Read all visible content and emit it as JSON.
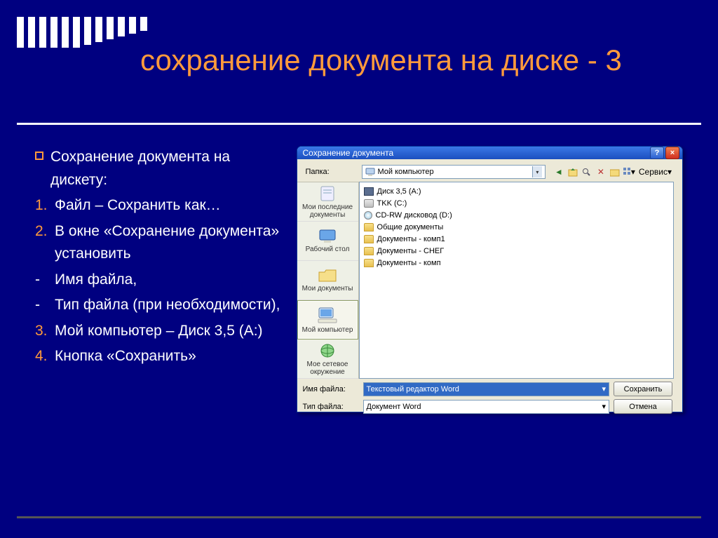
{
  "slide": {
    "title": "сохранение документа на диске - 3",
    "intro": "Сохранение документа на дискету:",
    "items": [
      {
        "type": "num",
        "n": "1.",
        "text": "Файл – Сохранить как…"
      },
      {
        "type": "num",
        "n": "2.",
        "text": "В окне «Сохранение документа» установить"
      },
      {
        "type": "dash",
        "n": "-",
        "text": "Имя файла,"
      },
      {
        "type": "dash",
        "n": "-",
        "text": "Тип файла (при необходимости),"
      },
      {
        "type": "num",
        "n": "3.",
        "text": "Мой компьютер – Диск 3,5 (А:)"
      },
      {
        "type": "num",
        "n": "4.",
        "text": "Кнопка «Сохранить»"
      }
    ]
  },
  "dialog": {
    "title": "Сохранение документа",
    "folder_label": "Папка:",
    "folder_value": "Мой компьютер",
    "service_label": "Сервис",
    "places": {
      "recent": "Мои последние документы",
      "desktop": "Рабочий стол",
      "mydocs": "Мои документы",
      "mycomp": "Мой компьютер",
      "network": "Мое сетевое окружение"
    },
    "files": [
      {
        "icon": "floppy",
        "name": "Диск 3,5 (A:)"
      },
      {
        "icon": "drive",
        "name": "TKK (C:)"
      },
      {
        "icon": "cd",
        "name": "CD-RW дисковод (D:)"
      },
      {
        "icon": "folder",
        "name": "Общие документы"
      },
      {
        "icon": "folder",
        "name": "Документы - комп1"
      },
      {
        "icon": "folder",
        "name": "Документы - СНЕГ"
      },
      {
        "icon": "folder",
        "name": "Документы - комп"
      }
    ],
    "filename_label": "Имя файла:",
    "filename_value": "Текстовый редактор Word",
    "filetype_label": "Тип файла:",
    "filetype_value": "Документ Word",
    "save_btn": "Сохранить",
    "cancel_btn": "Отмена"
  }
}
